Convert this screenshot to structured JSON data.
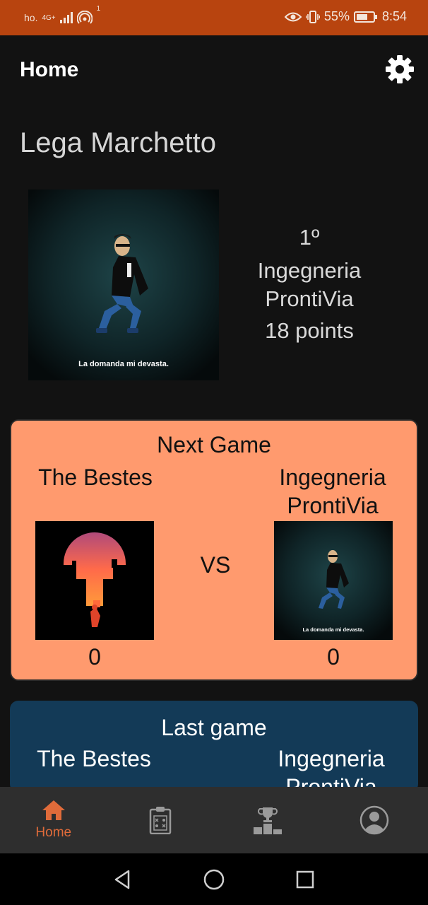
{
  "status_bar": {
    "carrier": "ho.",
    "network": "4G+",
    "notification_count": "1",
    "battery": "55%",
    "time": "8:54"
  },
  "app_bar": {
    "title": "Home",
    "settings_icon": "gear-icon"
  },
  "league": {
    "name": "Lega Marchetto"
  },
  "my_team": {
    "rank": "1º",
    "name_line1": "Ingegneria",
    "name_line2": "ProntiVia",
    "points": "18 points",
    "avatar_caption": "La domanda mi devasta."
  },
  "next_game": {
    "title": "Next Game",
    "home_team": "The Bestes",
    "away_team_line1": "Ingegneria",
    "away_team_line2": "ProntiVia",
    "vs": "VS",
    "home_score": "0",
    "away_score": "0"
  },
  "last_game": {
    "title": "Last game",
    "home_team": "The Bestes",
    "away_team_line1": "Ingegneria",
    "away_team_line2": "ProntiVia"
  },
  "bottom_nav": {
    "items": [
      {
        "label": "Home",
        "icon": "home-icon",
        "active": true
      },
      {
        "label": "",
        "icon": "lineup-board-icon",
        "active": false
      },
      {
        "label": "",
        "icon": "trophy-podium-icon",
        "active": false
      },
      {
        "label": "",
        "icon": "profile-icon",
        "active": false
      }
    ]
  },
  "colors": {
    "status_bar": "#b8440f",
    "accent": "#e06b3a",
    "next_card": "#ff9a6e",
    "last_card": "#133a57",
    "background": "#121212"
  }
}
